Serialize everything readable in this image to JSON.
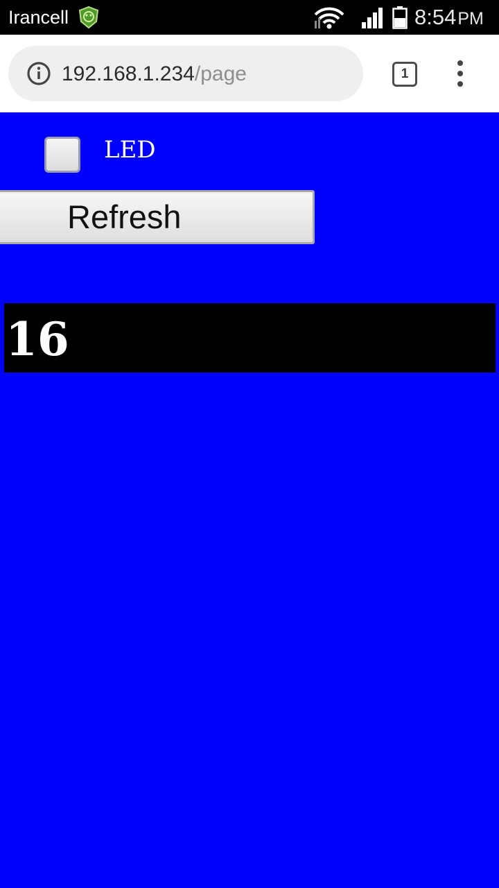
{
  "status_bar": {
    "carrier": "Irancell",
    "time": "8:54",
    "ampm": "PM",
    "icons": [
      "carrier-badge-icon",
      "wifi-icon",
      "signal-icon",
      "battery-icon"
    ]
  },
  "browser": {
    "url_host": "192.168.1.234",
    "url_path": "/page",
    "tab_count": "1",
    "icons": [
      "info-icon",
      "more-vert-icon"
    ]
  },
  "page": {
    "checkbox_label": "LED",
    "checkbox_checked": false,
    "refresh_label": "Refresh",
    "value": "16"
  },
  "colors": {
    "page_background": "#0000fe",
    "value_box_background": "#000000",
    "value_text": "#ffffff",
    "carrier_badge_green": "#4f9a2f"
  }
}
